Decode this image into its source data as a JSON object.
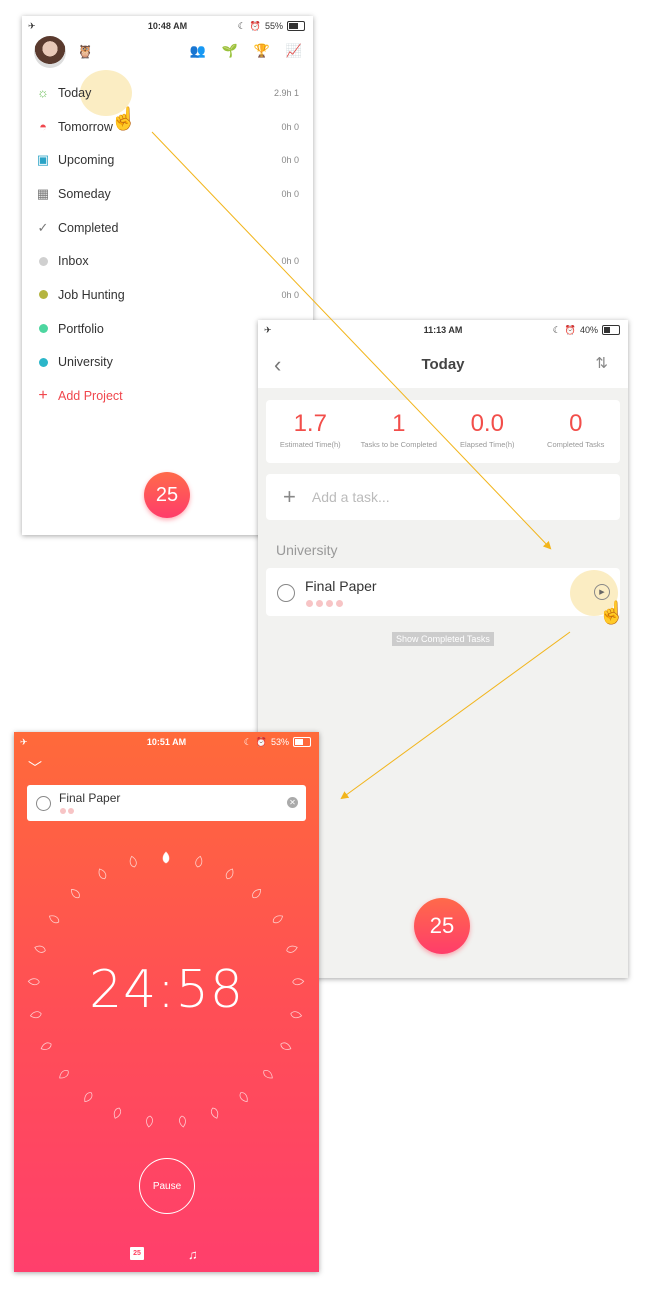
{
  "screen1": {
    "status": {
      "time": "10:48 AM",
      "battery": "55%",
      "battery_level": 0.55
    },
    "menu": [
      {
        "label": "Today",
        "num": "2.9h  1",
        "icon": "sun-icon",
        "color": "#6bbf59"
      },
      {
        "label": "Tomorrow",
        "num": "0h  0",
        "icon": "sunset-icon",
        "color": "#f0474d"
      },
      {
        "label": "Upcoming",
        "num": "0h  0",
        "icon": "calendar-icon",
        "color": "#2aa3c6"
      },
      {
        "label": "Someday",
        "num": "0h  0",
        "icon": "calendar-grid-icon",
        "color": "#777"
      },
      {
        "label": "Completed",
        "num": "",
        "icon": "check-circle-icon",
        "color": "#777"
      },
      {
        "label": "Inbox",
        "num": "0h  0",
        "icon": "dot-icon",
        "color": "#d0d0d0"
      },
      {
        "label": "Job Hunting",
        "num": "0h  0",
        "icon": "dot-icon",
        "color": "#b5b540"
      },
      {
        "label": "Portfolio",
        "num": "",
        "icon": "dot-icon",
        "color": "#4dd6a0"
      },
      {
        "label": "University",
        "num": "",
        "icon": "dot-icon",
        "color": "#2bb6c9"
      }
    ],
    "add_project": "Add Project",
    "fab": "25"
  },
  "screen2": {
    "status": {
      "time": "11:13 AM",
      "battery": "40%",
      "battery_level": 0.4
    },
    "title": "Today",
    "stats": [
      {
        "value": "1.7",
        "label": "Estimated Time(h)"
      },
      {
        "value": "1",
        "label": "Tasks to be Completed"
      },
      {
        "value": "0.0",
        "label": "Elapsed Time(h)"
      },
      {
        "value": "0",
        "label": "Completed Tasks"
      }
    ],
    "add_task_placeholder": "Add a task...",
    "section": "University",
    "task": {
      "name": "Final Paper",
      "pomodoros": 4
    },
    "show_completed": "Show Completed Tasks",
    "fab": "25"
  },
  "screen3": {
    "status": {
      "time": "10:51 AM",
      "battery": "53%",
      "battery_level": 0.53
    },
    "task": {
      "name": "Final Paper",
      "pomodoros": 2
    },
    "timer": "24:58",
    "pause": "Pause",
    "calendar_badge": "25",
    "colors": {
      "accent": "#f24e4a",
      "gradient_top": "#ff6a3a",
      "gradient_bottom": "#ff3f6c"
    }
  }
}
